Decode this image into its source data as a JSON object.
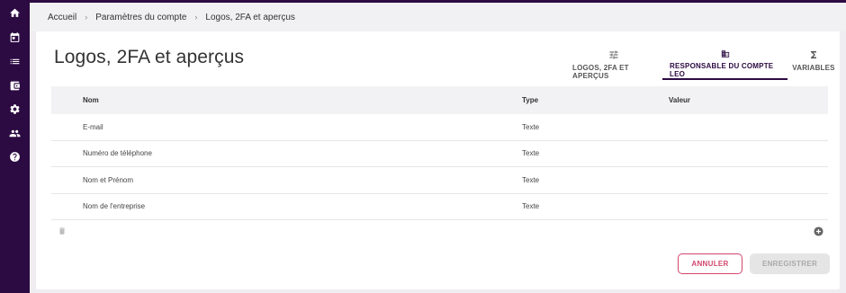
{
  "sidebar": {
    "items": [
      {
        "icon": "home-icon"
      },
      {
        "icon": "calendar-icon"
      },
      {
        "icon": "list-icon"
      },
      {
        "icon": "wallet-icon"
      },
      {
        "icon": "gear-icon"
      },
      {
        "icon": "users-icon"
      },
      {
        "icon": "help-icon"
      }
    ]
  },
  "breadcrumb": {
    "items": [
      "Accueil",
      "Paramètres du compte",
      "Logos, 2FA et aperçus"
    ],
    "separator": "›"
  },
  "page": {
    "title": "Logos, 2FA et aperçus"
  },
  "tabs": [
    {
      "label": "LOGOS, 2FA ET APERÇUS",
      "icon": "sliders-icon",
      "active": false
    },
    {
      "label": "RESPONSABLE DU COMPTE LEO",
      "icon": "building-icon",
      "active": true
    },
    {
      "label": "VARIABLES",
      "icon": "sigma-icon",
      "active": false
    }
  ],
  "table": {
    "headers": {
      "name": "Nom",
      "type": "Type",
      "value": "Valeur"
    },
    "rows": [
      {
        "name": "E-mail",
        "type": "Texte",
        "value": ""
      },
      {
        "name": "Numéro de téléphone",
        "type": "Texte",
        "value": ""
      },
      {
        "name": "Nom et Prénom",
        "type": "Texte",
        "value": ""
      },
      {
        "name": "Nom de l'entreprise",
        "type": "Texte",
        "value": ""
      }
    ]
  },
  "actions": {
    "cancel_label": "ANNULER",
    "save_label": "ENREGISTRER"
  },
  "colors": {
    "sidebar": "#2c0a42",
    "accent": "#2c0a42",
    "cancel": "#d2456e",
    "disabled_bg": "#e5e5e5"
  }
}
